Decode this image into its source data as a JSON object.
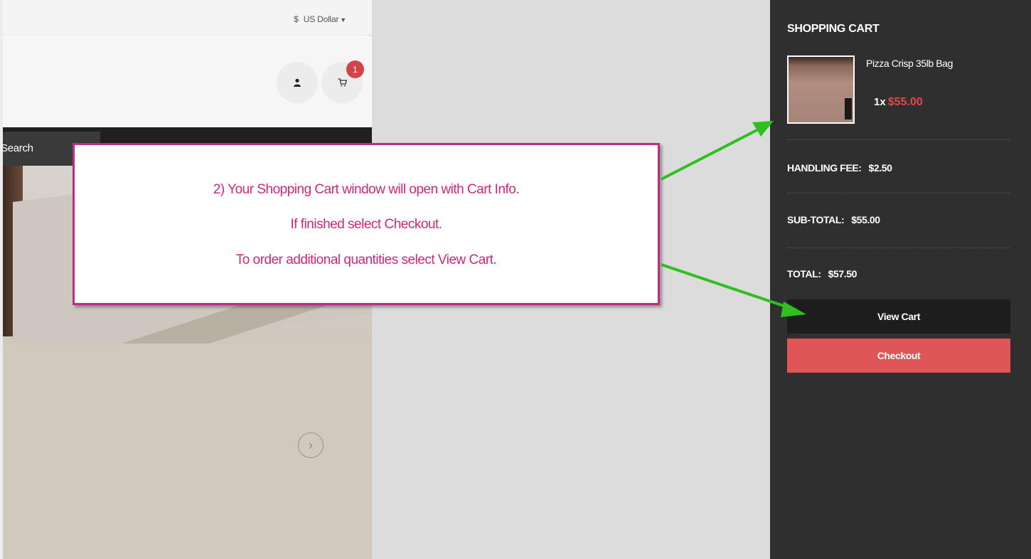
{
  "store": {
    "currency_symbol": "$",
    "currency_label": "US Dollar",
    "cart_count": "1",
    "search_label": "Search",
    "icons": {
      "user": "user-icon",
      "cart": "cart-icon",
      "next": "chevron-right-circle-icon"
    }
  },
  "annotation": {
    "line1": "2) Your Shopping Cart window will open with Cart Info.",
    "line2": "If finished select Checkout.",
    "line3": "To order additional quantities select View Cart.",
    "color": "#d1267f",
    "arrow_color": "#2fbf1f"
  },
  "cart": {
    "title": "SHOPPING CART",
    "item": {
      "name": "Pizza Crisp 35lb Bag",
      "qty": "1",
      "qty_sep": "x",
      "price": "$55.00"
    },
    "handling_fee_label": "HANDLING FEE:",
    "handling_fee": "$2.50",
    "subtotal_label": "SUB-TOTAL:",
    "subtotal": "$55.00",
    "total_label": "TOTAL:",
    "total": "$57.50",
    "view_cart_label": "View Cart",
    "checkout_label": "Checkout",
    "colors": {
      "panel_bg": "#2f2f2f",
      "price": "#e0484f",
      "checkout_bg": "#e05656"
    }
  }
}
